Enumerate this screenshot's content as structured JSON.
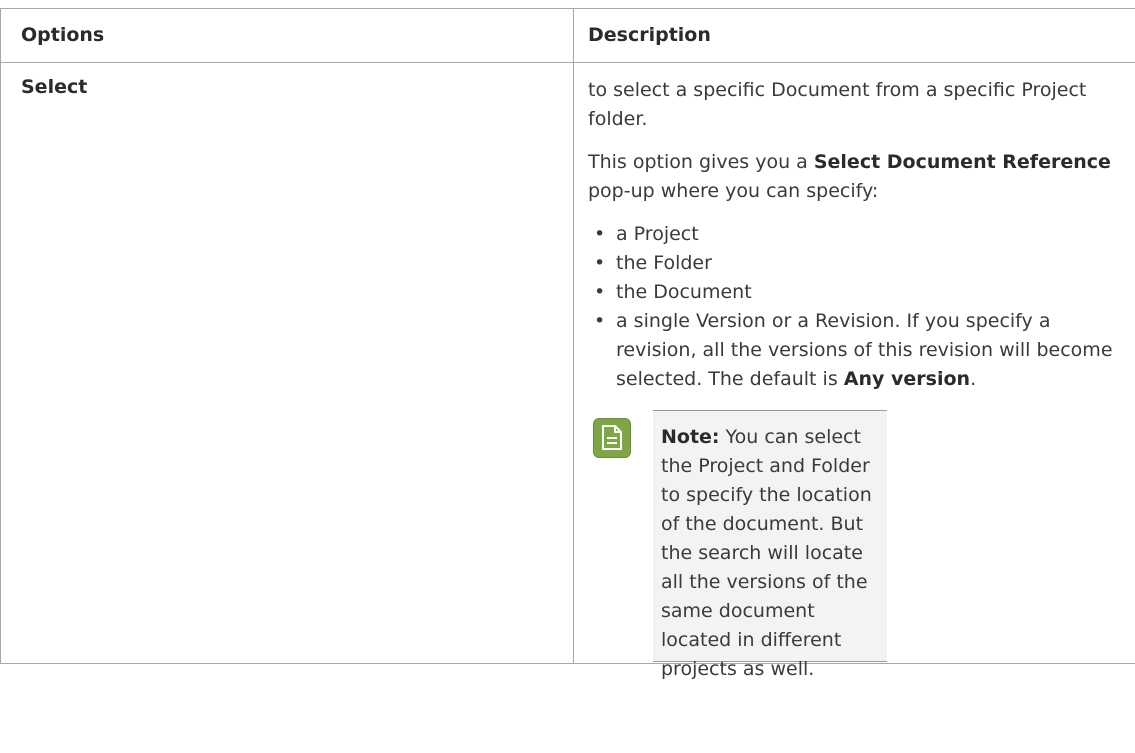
{
  "table": {
    "header": {
      "options": "Options",
      "description": "Description"
    },
    "row": {
      "option": "Select",
      "intro": "to select a specific Document from a specific Project folder.",
      "popup_pre": "This option gives you a ",
      "popup_bold": "Select Document Reference",
      "popup_post": " pop-up where you can specify:",
      "bullets": [
        "a Project",
        "the Folder",
        "the Document"
      ],
      "last_bullet_pre": "a single Version or a Revision. If you specify a revision, all the versions of this revision will become selected. The default is ",
      "last_bullet_bold": "Any version",
      "last_bullet_post": "."
    }
  },
  "note": {
    "icon": "note-document-icon",
    "icon_color": "#7ea646",
    "label": "Note:",
    "text": "You can select the Project and Folder to specify the location of the document. But the search will locate all the versions of the same document located in different projects as well."
  }
}
